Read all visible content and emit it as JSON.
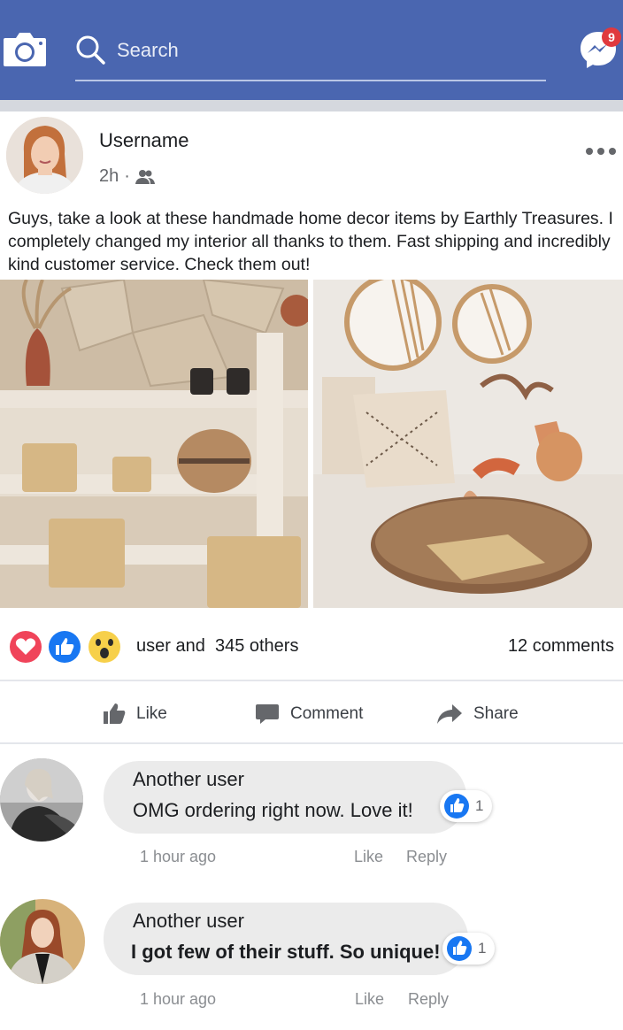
{
  "header": {
    "search_placeholder": "Search",
    "messenger_badge": "9",
    "icons": [
      "camera-icon",
      "search-icon",
      "messenger-icon"
    ],
    "colors": {
      "bar": "#4a66b0",
      "badge": "#e0393e"
    }
  },
  "post": {
    "username": "Username",
    "time": "2h",
    "separator": "·",
    "audience_icon": "friends-icon",
    "text": "Guys, take a look at these handmade home decor items by Earthly Treasures. I completely changed my interior all thanks to them. Fast shipping and incredibly kind customer service. Check them out!",
    "reactions_text": "user and  345 others",
    "comments_count": "12 comments",
    "actions": {
      "like": "Like",
      "comment": "Comment",
      "share": "Share"
    }
  },
  "comments": [
    {
      "name": "Another user",
      "text": "OMG ordering right now. Love it!",
      "likes": "1",
      "time": "1 hour ago",
      "like_label": "Like",
      "reply_label": "Reply"
    },
    {
      "name": "Another user",
      "text": "I got few of their stuff. So unique!",
      "likes": "1",
      "time": "1 hour ago",
      "like_label": "Like",
      "reply_label": "Reply"
    }
  ]
}
